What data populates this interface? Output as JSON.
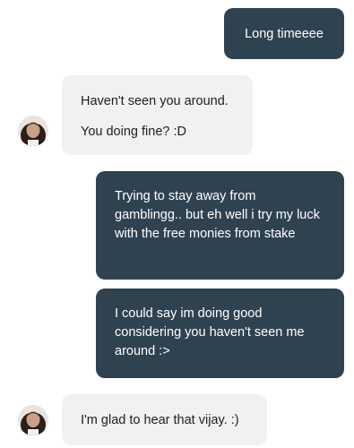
{
  "conversation": {
    "messages": [
      {
        "direction": "outgoing",
        "lines": [
          "Long timeeee"
        ]
      },
      {
        "direction": "incoming",
        "lines": [
          "Haven't seen you around.",
          "You doing fine? :D"
        ]
      },
      {
        "direction": "outgoing",
        "lines": [
          "Trying to stay away from gamblingg.. but eh well i try my luck with the free monies from stake"
        ]
      },
      {
        "direction": "outgoing",
        "lines": [
          "I could say im doing good considering you haven't seen me around :>"
        ]
      },
      {
        "direction": "incoming",
        "lines": [
          "I'm glad to hear that vijay. :)"
        ]
      }
    ]
  },
  "colors": {
    "outgoing_bubble": "#2f4250",
    "incoming_bubble": "#f1f1f1",
    "outgoing_text": "#ffffff",
    "incoming_text": "#1e1e1e"
  },
  "icons": {
    "contact_avatar": "avatar-photo"
  }
}
